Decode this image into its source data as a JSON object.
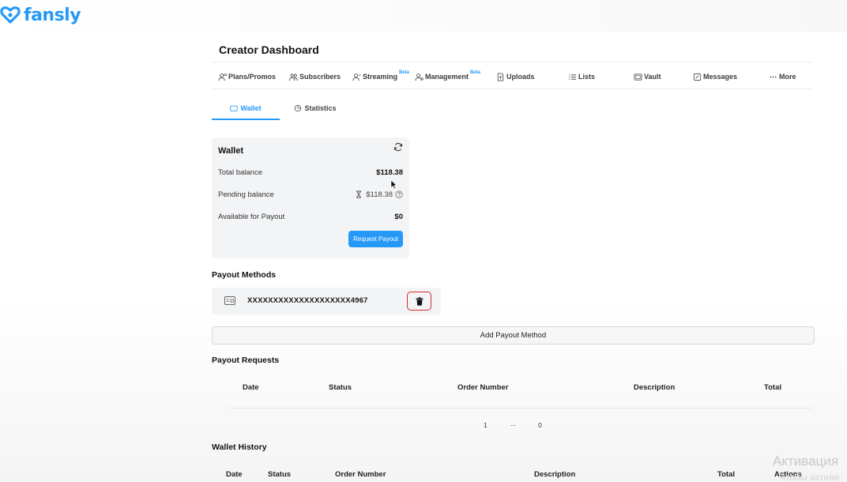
{
  "brand": {
    "name": "fansly",
    "color": "#2699f7",
    "icon": "heart-link-icon"
  },
  "page": {
    "title": "Creator Dashboard"
  },
  "nav": {
    "items": [
      {
        "label": "Plans/Promos",
        "icon": "person-tag-icon",
        "beta": ""
      },
      {
        "label": "Subscribers",
        "icon": "people-icon",
        "beta": ""
      },
      {
        "label": "Streaming",
        "icon": "person-stream-icon",
        "beta": "Beta"
      },
      {
        "label": "Management",
        "icon": "person-gear-icon",
        "beta": "Beta"
      },
      {
        "label": "Uploads",
        "icon": "file-upload-icon",
        "beta": ""
      },
      {
        "label": "Lists",
        "icon": "list-icon",
        "beta": ""
      },
      {
        "label": "Vault",
        "icon": "vault-icon",
        "beta": ""
      },
      {
        "label": "Messages",
        "icon": "message-icon",
        "beta": ""
      },
      {
        "label": "More",
        "icon": "ellipsis-icon",
        "beta": ""
      }
    ]
  },
  "subtabs": {
    "wallet": "Wallet",
    "statistics": "Statistics",
    "active": "wallet"
  },
  "wallet": {
    "title": "Wallet",
    "rows": [
      {
        "label": "Total balance",
        "value": "$118.38"
      },
      {
        "label": "Pending balance",
        "value": "$118.38"
      },
      {
        "label": "Available for Payout",
        "value": "$0"
      }
    ],
    "request_button": "Request Payout"
  },
  "payout_methods": {
    "heading": "Payout Methods",
    "items": [
      {
        "number": "XXXXXXXXXXXXXXXXXXXX4967",
        "icon": "card-icon"
      }
    ],
    "delete_highlight_color": "#d62b2b",
    "add_button": "Add Payout Method"
  },
  "payout_requests": {
    "heading": "Payout Requests",
    "columns": [
      "Date",
      "Status",
      "Order Number",
      "Description",
      "Total"
    ],
    "pagination": [
      "1",
      "...",
      "0"
    ]
  },
  "wallet_history": {
    "heading": "Wallet History",
    "columns": [
      "Date",
      "Status",
      "Order Number",
      "Description",
      "Total",
      "Actions"
    ]
  },
  "watermark": {
    "line1": "Активация",
    "line2": "Чтобы активи"
  }
}
